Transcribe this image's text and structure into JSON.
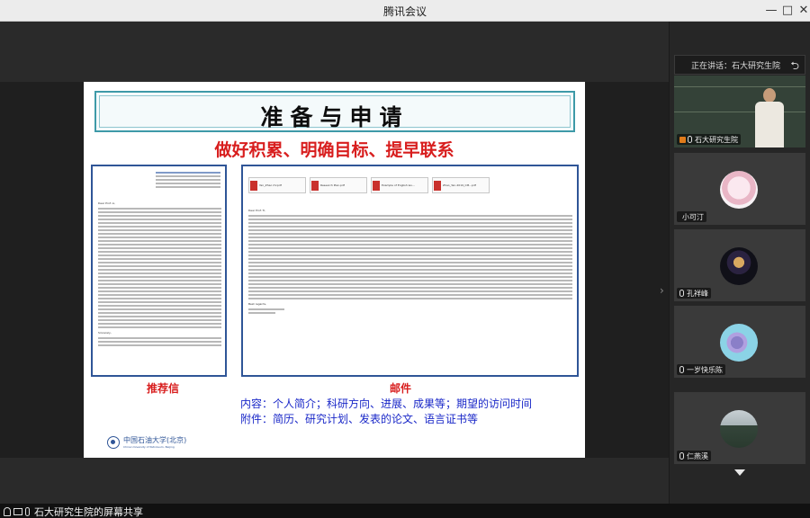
{
  "window": {
    "title": "腾讯会议"
  },
  "slide": {
    "title": "准备与申请",
    "subtitle": "做好积累、明确目标、提早联系",
    "label_letter": "推荐信",
    "label_email": "邮件",
    "content_line": "内容：个人简介；科研方向、进展、成果等；期望的访问时间",
    "attachments_line": "附件：简历、研究计划、发表的论文、语言证书等",
    "logo_text": "中国石油大学(北京)",
    "logo_en": "China University of Petroleum, Beijing",
    "letter_greeting": "Dear Prof. Li,",
    "letter_closing": "Sincerely,",
    "email_greeting": "Dear Prof. Ti,",
    "email_closing": "Best regards,",
    "email_attachments": [
      "Yan_Zhao CV.pdf",
      "Research Plan.pdf",
      "Example of English lev...",
      "Zhao_Yan-2019_CM...pdf"
    ]
  },
  "panel": {
    "header": "正在讲话：石大研究生院",
    "tiles": [
      {
        "name": "石大研究生院"
      },
      {
        "name": "小可汀"
      },
      {
        "name": "孔祥峰"
      },
      {
        "name": "一岁快乐陈"
      },
      {
        "name": "仁燕溪"
      }
    ]
  },
  "bottombar": {
    "share_label": "石大研究生院的屏幕共享"
  }
}
